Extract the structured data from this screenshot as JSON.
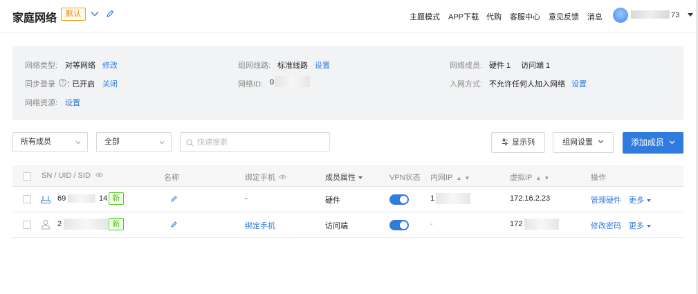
{
  "header": {
    "title": "家庭网络",
    "default_badge": "默认",
    "nav": [
      "主题模式",
      "APP下载",
      "代购",
      "客服中心",
      "意见反馈",
      "消息"
    ],
    "user_suffix": "73"
  },
  "info": {
    "network_type_label": "网络类型:",
    "network_type_value": "对等网络",
    "network_type_action": "修改",
    "sync_login_label": "同步登录",
    "sync_login_value": ": 已开启",
    "sync_login_action": "关闭",
    "resources_label": "网络资源:",
    "resources_action": "设置",
    "route_label": "组网线路:",
    "route_value": "标准线路",
    "route_action": "设置",
    "network_id_label": "网络ID:",
    "network_id_prefix": "0",
    "members_label": "网络成员:",
    "members_hardware": "硬件 1",
    "members_visitor": "访问端 1",
    "join_label": "入网方式:",
    "join_value": "不允许任何人加入网络",
    "join_action": "设置"
  },
  "toolbar": {
    "member_filter": "所有成员",
    "status_filter": "全部",
    "search_placeholder": "快速搜索",
    "columns_button": "显示列",
    "network_settings_button": "组网设置",
    "add_member_button": "添加成员"
  },
  "table": {
    "headers": {
      "id": "SN / UID / SID",
      "name": "名称",
      "phone": "绑定手机",
      "attr": "成员属性",
      "vpn": "VPN状态",
      "lan_ip": "内网IP",
      "virtual_ip": "虚拟IP",
      "actions": "操作"
    },
    "rows": [
      {
        "id_prefix": "69",
        "id_suffix": "14",
        "badge": "新",
        "phone": "-",
        "attr": "硬件",
        "vpn_on": true,
        "lan_ip": "1",
        "virtual_ip": "172.16.2.23",
        "action_primary": "管理硬件",
        "action_more": "更多"
      },
      {
        "id_prefix": "2",
        "id_suffix": "",
        "badge": "新",
        "phone": "绑定手机",
        "attr": "访问端",
        "vpn_on": true,
        "lan_ip": "-",
        "virtual_ip": "172",
        "action_primary": "修改密码",
        "action_more": "更多"
      }
    ]
  }
}
